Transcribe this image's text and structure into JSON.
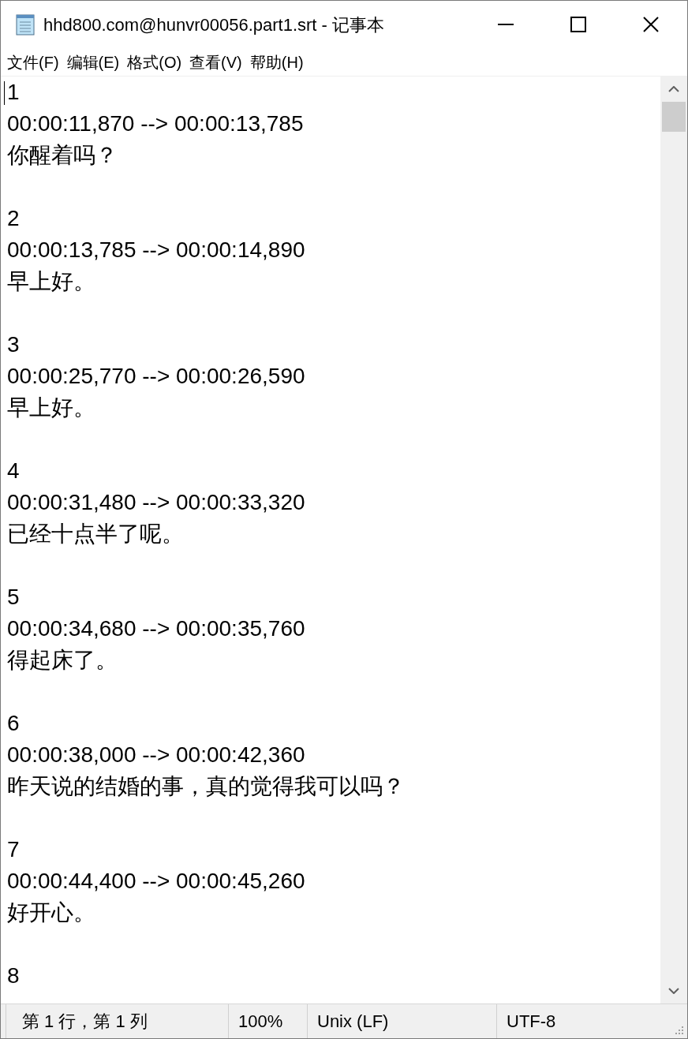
{
  "window": {
    "title": "hhd800.com@hunvr00056.part1.srt - 记事本"
  },
  "menu": [
    "文件(F)",
    "编辑(E)",
    "格式(O)",
    "查看(V)",
    "帮助(H)"
  ],
  "editor": {
    "entries": [
      {
        "index": "1",
        "time": "00:00:11,870 --> 00:00:13,785",
        "text": "你醒着吗？"
      },
      {
        "index": "2",
        "time": "00:00:13,785 --> 00:00:14,890",
        "text": "早上好。"
      },
      {
        "index": "3",
        "time": "00:00:25,770 --> 00:00:26,590",
        "text": "早上好。"
      },
      {
        "index": "4",
        "time": "00:00:31,480 --> 00:00:33,320",
        "text": "已经十点半了呢。"
      },
      {
        "index": "5",
        "time": "00:00:34,680 --> 00:00:35,760",
        "text": "得起床了。"
      },
      {
        "index": "6",
        "time": "00:00:38,000 --> 00:00:42,360",
        "text": "昨天说的结婚的事，真的觉得我可以吗？"
      },
      {
        "index": "7",
        "time": "00:00:44,400 --> 00:00:45,260",
        "text": "好开心。"
      },
      {
        "index": "8"
      }
    ]
  },
  "status_bar": [
    "第 1 行，第 1 列",
    "100%",
    "Unix (LF)",
    "UTF-8"
  ]
}
